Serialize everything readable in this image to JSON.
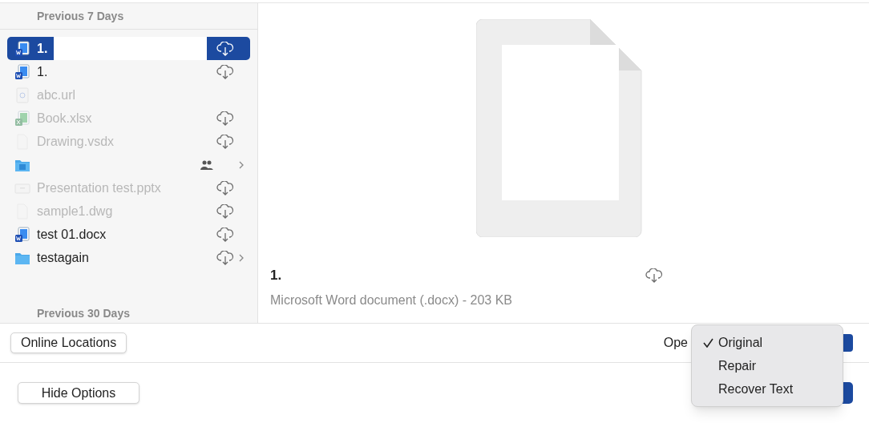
{
  "sidebar": {
    "sections": [
      {
        "title": "Previous 7 Days"
      },
      {
        "title": "Previous 30 Days"
      }
    ],
    "items": [
      {
        "kind": "word",
        "name": "1.",
        "selected": true,
        "disabled": false,
        "cloud": true,
        "chevron": false,
        "shared": false,
        "editing": true
      },
      {
        "kind": "word",
        "name": "1.",
        "selected": false,
        "disabled": false,
        "cloud": true,
        "chevron": false,
        "shared": false,
        "editing": false
      },
      {
        "kind": "url",
        "name": "abc.url",
        "selected": false,
        "disabled": true,
        "cloud": false,
        "chevron": false,
        "shared": false,
        "editing": false
      },
      {
        "kind": "excel",
        "name": "Book.xlsx",
        "selected": false,
        "disabled": true,
        "cloud": true,
        "chevron": false,
        "shared": false,
        "editing": false
      },
      {
        "kind": "blank",
        "name": "Drawing.vsdx",
        "selected": false,
        "disabled": true,
        "cloud": true,
        "chevron": false,
        "shared": false,
        "editing": false
      },
      {
        "kind": "shared-folder",
        "selected": false,
        "disabled": false,
        "cloud": false,
        "chevron": true,
        "shared": true,
        "editing": false
      },
      {
        "kind": "slides",
        "name": "Presentation test.pptx",
        "selected": false,
        "disabled": true,
        "cloud": true,
        "chevron": false,
        "shared": false,
        "editing": false
      },
      {
        "kind": "blank",
        "name": "sample1.dwg",
        "selected": false,
        "disabled": true,
        "cloud": true,
        "chevron": false,
        "shared": false,
        "editing": false
      },
      {
        "kind": "word",
        "name": "test 01.docx",
        "selected": false,
        "disabled": false,
        "cloud": true,
        "chevron": false,
        "shared": false,
        "editing": false
      },
      {
        "kind": "folder",
        "name": "testagain",
        "selected": false,
        "disabled": false,
        "cloud": true,
        "chevron": true,
        "shared": false,
        "editing": false
      }
    ]
  },
  "preview": {
    "name": "1.",
    "cloud": true,
    "details": "Microsoft Word document (.docx) - 203 KB"
  },
  "options_bar": {
    "online_button": "Online Locations",
    "open_label": "Ope"
  },
  "footer": {
    "hide_button": "Hide Options"
  },
  "open_menu": {
    "items": [
      {
        "label": "Original",
        "selected": true
      },
      {
        "label": "Repair",
        "selected": false
      },
      {
        "label": "Recover Text",
        "selected": false
      }
    ]
  }
}
